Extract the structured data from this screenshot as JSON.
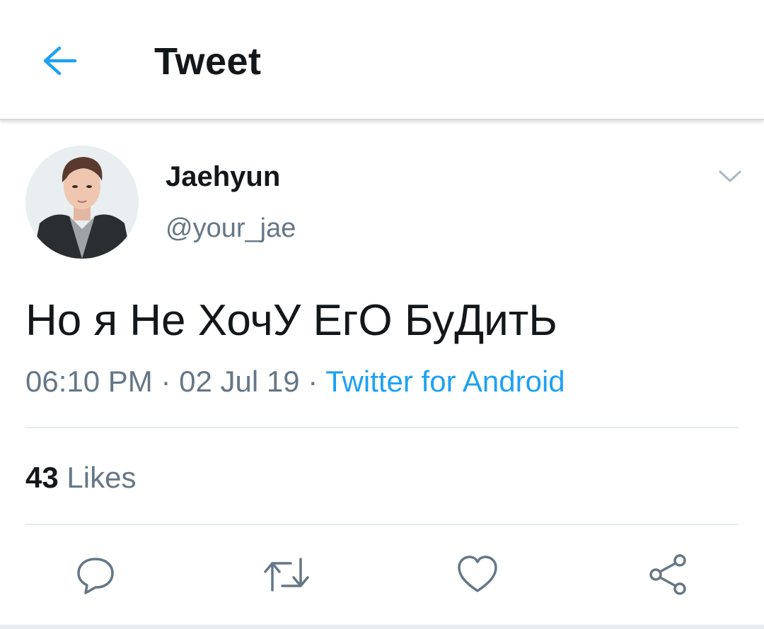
{
  "header": {
    "back_icon": "arrow-left-icon",
    "title": "Tweet"
  },
  "tweet": {
    "display_name": "Jaehyun",
    "handle": "@your_jae",
    "text": "Но я Не ХочУ ЕгО БуДитЬ",
    "time": "06:10 PM",
    "separator": "·",
    "date": "02 Jul 19",
    "source": "Twitter for Android",
    "likes_count": "43",
    "likes_label": "Likes"
  },
  "actions": {
    "reply_icon": "reply-icon",
    "retweet_icon": "retweet-icon",
    "like_icon": "heart-icon",
    "share_icon": "share-icon"
  },
  "colors": {
    "accent": "#1da1f2",
    "text_primary": "#14171a",
    "text_secondary": "#657786",
    "divider": "#e6ecf0"
  }
}
